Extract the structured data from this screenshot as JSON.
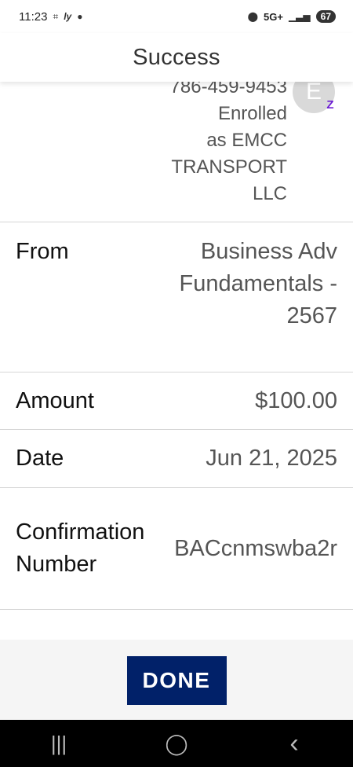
{
  "status_bar": {
    "time": "11:23",
    "network": "5G+",
    "battery": "67"
  },
  "header": {
    "title": "Success"
  },
  "recipient": {
    "phone": "786-459-9453",
    "enrolled_line1": "Enrolled",
    "enrolled_line2": "as EMCC",
    "name_line1": "TRANSPORT",
    "name_line2": "LLC",
    "avatar_initial": "E",
    "badge": "Z"
  },
  "details": {
    "from_label": "From",
    "from_value": "Business Adv Fundamentals - 2567",
    "amount_label": "Amount",
    "amount_value": "$100.00",
    "date_label": "Date",
    "date_value": "Jun 21, 2025",
    "confirmation_label": "Confirmation Number",
    "confirmation_value": "BACcnmswba2r"
  },
  "footer": {
    "done_label": "DONE"
  },
  "nav_bar": {
    "recents_glyph": "|||",
    "home_glyph": "◯",
    "back_glyph": "‹"
  },
  "icons": {
    "status_left": [
      "screenshot-icon",
      "lyft-icon",
      "message-icon"
    ],
    "status_right": [
      "location-icon",
      "signal-icon",
      "battery-icon"
    ]
  },
  "colors": {
    "done_button": "#012169",
    "zelle_purple": "#6d1ed4"
  }
}
